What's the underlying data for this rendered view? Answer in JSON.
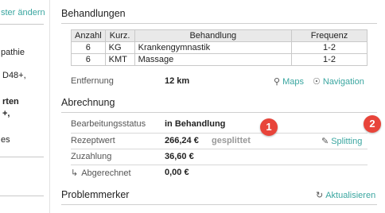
{
  "left_panel": {
    "link_text": "ster ändern",
    "lines": [
      "pathie",
      "D48+,",
      "rten",
      "+,",
      "es"
    ]
  },
  "behandlungen": {
    "title": "Behandlungen",
    "columns": [
      "Anzahl",
      "Kurz.",
      "Behandlung",
      "Frequenz"
    ],
    "rows": [
      [
        "6",
        "KG",
        "Krankengymnastik",
        "1-2"
      ],
      [
        "6",
        "KMT",
        "Massage",
        "1-2"
      ]
    ],
    "entfernung_label": "Entfernung",
    "entfernung_value": "12 km",
    "maps_label": "Maps",
    "navigation_label": "Navigation"
  },
  "abrechnung": {
    "title": "Abrechnung",
    "status_label": "Bearbeitungsstatus",
    "status_value": "in Behandlung",
    "rezeptwert_label": "Rezeptwert",
    "rezeptwert_value": "266,24 €",
    "gesplittet_label": "gesplittet",
    "splitting_label": "Splitting",
    "zuzahlung_label": "Zuzahlung",
    "zuzahlung_value": "36,60 €",
    "abgerechnet_label": "Abgerechnet",
    "abgerechnet_value": "0,00 €"
  },
  "problemmerker": {
    "title": "Problemmerker",
    "refresh_label": "Aktualisieren"
  },
  "badges": [
    "1",
    "2"
  ],
  "colors": {
    "accent": "#3aa6a0",
    "badge": "#e8443a"
  }
}
